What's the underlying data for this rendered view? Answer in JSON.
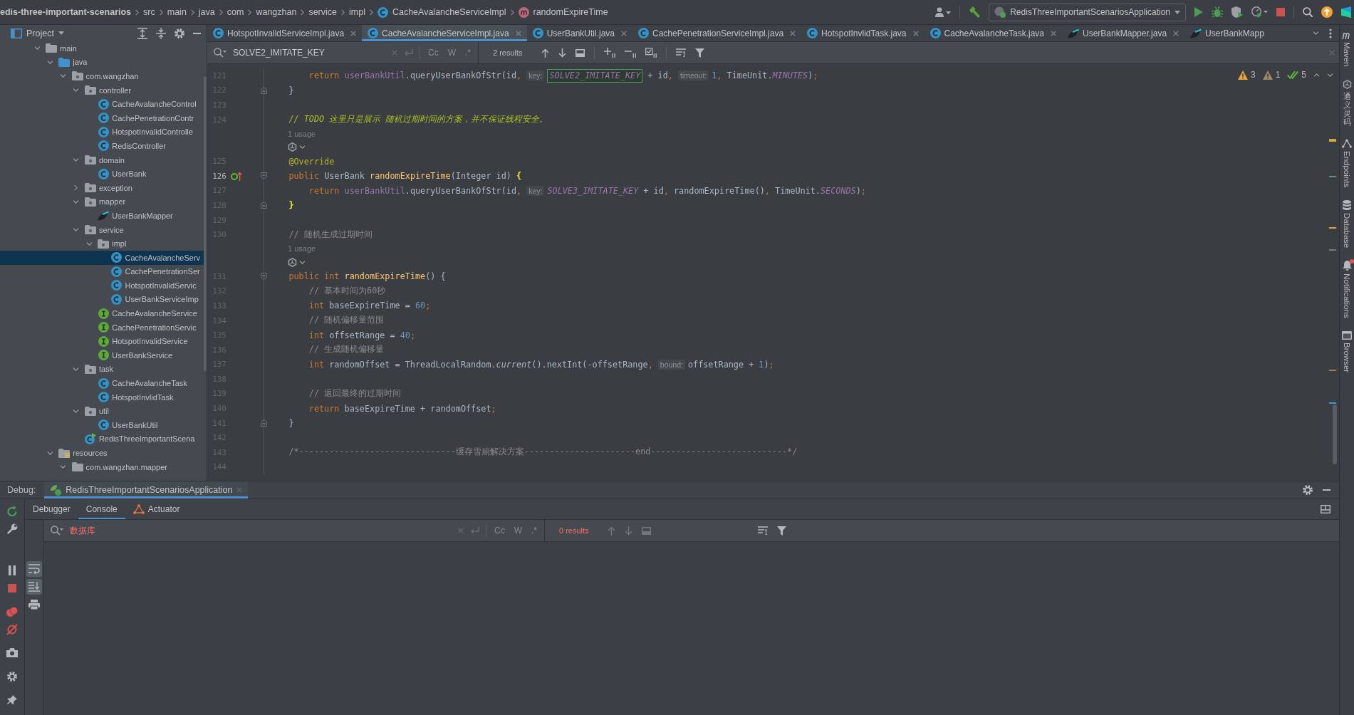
{
  "toolbar": {
    "breadcrumbs": [
      {
        "kind": "project",
        "text": "edis-three-important-scenarios"
      },
      {
        "kind": "folder",
        "text": "src"
      },
      {
        "kind": "folder",
        "text": "main"
      },
      {
        "kind": "folder",
        "text": "java"
      },
      {
        "kind": "folder",
        "text": "com"
      },
      {
        "kind": "folder",
        "text": "wangzhan"
      },
      {
        "kind": "folder",
        "text": "service"
      },
      {
        "kind": "folder",
        "text": "impl"
      },
      {
        "kind": "class",
        "text": "CacheAvalancheServiceImpl"
      },
      {
        "kind": "method",
        "text": "randomExpireTime"
      }
    ],
    "run_config": "RedisThreeImportantScenariosApplication"
  },
  "project_panel": {
    "title": "Project",
    "tree": [
      {
        "label": "main",
        "kind": "folder",
        "expanded": true,
        "selected": false,
        "children": [
          {
            "label": "java",
            "kind": "source_folder",
            "expanded": true,
            "selected": false,
            "children": [
              {
                "label": "com.wangzhan",
                "kind": "package",
                "expanded": true,
                "selected": false,
                "children": [
                  {
                    "label": "controller",
                    "kind": "package",
                    "expanded": true,
                    "selected": false,
                    "children": [
                      {
                        "label": "CacheAvalancheControl",
                        "kind": "class",
                        "selected": false
                      },
                      {
                        "label": "CachePenetrationContr",
                        "kind": "class",
                        "selected": false
                      },
                      {
                        "label": "HotspotInvalidControlle",
                        "kind": "class",
                        "selected": false
                      },
                      {
                        "label": "RedisController",
                        "kind": "class",
                        "selected": false
                      }
                    ]
                  },
                  {
                    "label": "domain",
                    "kind": "package",
                    "expanded": true,
                    "selected": false,
                    "children": [
                      {
                        "label": "UserBank",
                        "kind": "class",
                        "selected": false
                      }
                    ]
                  },
                  {
                    "label": "exception",
                    "kind": "package",
                    "expanded": false,
                    "selected": false
                  },
                  {
                    "label": "mapper",
                    "kind": "package",
                    "expanded": true,
                    "selected": false,
                    "children": [
                      {
                        "label": "UserBankMapper",
                        "kind": "mapper",
                        "selected": false
                      }
                    ]
                  },
                  {
                    "label": "service",
                    "kind": "package",
                    "expanded": true,
                    "selected": false,
                    "children": [
                      {
                        "label": "impl",
                        "kind": "package",
                        "expanded": true,
                        "selected": false,
                        "children": [
                          {
                            "label": "CacheAvalancheServ",
                            "kind": "class",
                            "selected": true
                          },
                          {
                            "label": "CachePenetrationSer",
                            "kind": "class",
                            "selected": false
                          },
                          {
                            "label": "HotspotInvalidServic",
                            "kind": "class",
                            "selected": false
                          },
                          {
                            "label": "UserBankServiceImp",
                            "kind": "class",
                            "selected": false
                          }
                        ]
                      },
                      {
                        "label": "CacheAvalancheService",
                        "kind": "interface",
                        "selected": false
                      },
                      {
                        "label": "CachePenetrationServic",
                        "kind": "interface",
                        "selected": false
                      },
                      {
                        "label": "HotspotInvalidService",
                        "kind": "interface",
                        "selected": false
                      },
                      {
                        "label": "UserBankService",
                        "kind": "interface",
                        "selected": false
                      }
                    ]
                  },
                  {
                    "label": "task",
                    "kind": "package",
                    "expanded": true,
                    "selected": false,
                    "children": [
                      {
                        "label": "CacheAvalancheTask",
                        "kind": "class",
                        "selected": false
                      },
                      {
                        "label": "HotspotInvlidTask",
                        "kind": "class",
                        "selected": false
                      }
                    ]
                  },
                  {
                    "label": "util",
                    "kind": "package",
                    "expanded": true,
                    "selected": false,
                    "children": [
                      {
                        "label": "UserBankUtil",
                        "kind": "class",
                        "selected": false
                      }
                    ]
                  },
                  {
                    "label": "RedisThreeImportantScena",
                    "kind": "application",
                    "selected": false
                  }
                ]
              }
            ]
          },
          {
            "label": "resources",
            "kind": "resources_folder",
            "expanded": true,
            "selected": false,
            "children": [
              {
                "label": "com.wangzhan.mapper",
                "kind": "folder",
                "expanded": true,
                "selected": false
              }
            ]
          }
        ]
      }
    ]
  },
  "editor_tabs": [
    {
      "label": "HotspotInvalidServiceImpl.java",
      "kind": "class",
      "selected": false,
      "closable": true
    },
    {
      "label": "CacheAvalancheServiceImpl.java",
      "kind": "class",
      "selected": true,
      "closable": true
    },
    {
      "label": "UserBankUtil.java",
      "kind": "class",
      "selected": false,
      "closable": true
    },
    {
      "label": "CachePenetrationServiceImpl.java",
      "kind": "class",
      "selected": false,
      "closable": true
    },
    {
      "label": "HotspotInvlidTask.java",
      "kind": "class",
      "selected": false,
      "closable": true
    },
    {
      "label": "CacheAvalancheTask.java",
      "kind": "class",
      "selected": false,
      "closable": true
    },
    {
      "label": "UserBankMapper.java",
      "kind": "mapper",
      "selected": false,
      "closable": true
    },
    {
      "label": "UserBankMapp",
      "kind": "mapper",
      "selected": false,
      "closable": false
    }
  ],
  "find_bar": {
    "value": "SOLVE2_IMITATE_KEY",
    "no_results": false,
    "options": [
      {
        "label": "Cc",
        "selected": false
      },
      {
        "label": "W",
        "selected": false
      },
      {
        "label": ".*",
        "selected": false
      }
    ],
    "results": "2 results"
  },
  "inspections": [
    {
      "kind": "warning",
      "count": "3"
    },
    {
      "kind": "weak_warning",
      "count": "1"
    },
    {
      "kind": "typo",
      "count": "5"
    }
  ],
  "code": [
    {
      "kind": "code",
      "number": "121",
      "current": false,
      "tokens": [
        {
          "kind": "keyword",
          "text": "        return"
        },
        {
          "kind": "field",
          "text": " userBankUtil"
        },
        {
          "kind": "text",
          "text": ".queryUserBankOfStr(id"
        },
        {
          "kind": "punct",
          "text": ","
        },
        {
          "kind": "hint",
          "text": "key:"
        },
        {
          "kind": "match",
          "text": "SOLVE2_IMITATE_KEY"
        },
        {
          "kind": "text",
          "text": " + id"
        },
        {
          "kind": "punct",
          "text": ","
        },
        {
          "kind": "hint",
          "text": "timeout:"
        },
        {
          "kind": "number",
          "text": "1"
        },
        {
          "kind": "punct",
          "text": ","
        },
        {
          "kind": "text",
          "text": " TimeUnit."
        },
        {
          "kind": "constant",
          "text": "MINUTES"
        },
        {
          "kind": "text",
          "text": ")"
        },
        {
          "kind": "punct",
          "text": ";"
        }
      ]
    },
    {
      "kind": "code",
      "number": "122",
      "current": false,
      "gutter": [
        {
          "kind": "fold_end"
        }
      ],
      "tokens": [
        {
          "kind": "text",
          "text": "    }"
        }
      ]
    },
    {
      "kind": "code",
      "number": "123",
      "current": false
    },
    {
      "kind": "code",
      "number": "124",
      "current": false,
      "tokens": [
        {
          "kind": "todo",
          "text": "    // TODO 这里只是展示 随机过期时间的方案，并不保证线程安全。"
        }
      ]
    },
    {
      "kind": "usage",
      "text": "1 usage"
    },
    {
      "kind": "vision"
    },
    {
      "kind": "code",
      "number": "125",
      "current": false,
      "tokens": [
        {
          "kind": "annotation",
          "text": "    @Override"
        }
      ]
    },
    {
      "kind": "code",
      "number": "126",
      "current": true,
      "gutter": [
        {
          "kind": "overrides"
        },
        {
          "kind": "fold_start"
        }
      ],
      "tokens": [
        {
          "kind": "keyword",
          "text": "    public"
        },
        {
          "kind": "text",
          "text": " UserBank "
        },
        {
          "kind": "method",
          "text": "randomExpireTime"
        },
        {
          "kind": "text",
          "text": "(Integer id) "
        },
        {
          "kind": "brace",
          "text": "{"
        }
      ]
    },
    {
      "kind": "code",
      "number": "127",
      "current": false,
      "tokens": [
        {
          "kind": "keyword",
          "text": "        return"
        },
        {
          "kind": "field",
          "text": " userBankUtil"
        },
        {
          "kind": "text",
          "text": ".queryUserBankOfStr(id"
        },
        {
          "kind": "punct",
          "text": ","
        },
        {
          "kind": "hint",
          "text": "key:"
        },
        {
          "kind": "constant",
          "text": "SOLVE3_IMITATE_KEY"
        },
        {
          "kind": "text",
          "text": " + id"
        },
        {
          "kind": "punct",
          "text": ","
        },
        {
          "kind": "text",
          "text": " randomExpireTime()"
        },
        {
          "kind": "punct",
          "text": ","
        },
        {
          "kind": "text",
          "text": " TimeUnit."
        },
        {
          "kind": "constant",
          "text": "SECONDS"
        },
        {
          "kind": "text",
          "text": ")"
        },
        {
          "kind": "punct",
          "text": ";"
        }
      ]
    },
    {
      "kind": "code",
      "number": "128",
      "current": false,
      "gutter": [
        {
          "kind": "fold_end"
        }
      ],
      "tokens": [
        {
          "kind": "brace",
          "text": "    }"
        }
      ]
    },
    {
      "kind": "code",
      "number": "129",
      "current": false
    },
    {
      "kind": "code",
      "number": "130",
      "current": false,
      "tokens": [
        {
          "kind": "comment",
          "text": "    // 随机生成过期时间"
        }
      ]
    },
    {
      "kind": "usage",
      "text": "1 usage"
    },
    {
      "kind": "vision"
    },
    {
      "kind": "code",
      "number": "131",
      "current": false,
      "gutter": [
        {
          "kind": "fold_start"
        }
      ],
      "tokens": [
        {
          "kind": "keyword",
          "text": "    public int "
        },
        {
          "kind": "method",
          "text": "randomExpireTime"
        },
        {
          "kind": "text",
          "text": "() {"
        }
      ]
    },
    {
      "kind": "code",
      "number": "132",
      "current": false,
      "tokens": [
        {
          "kind": "comment",
          "text": "        // 基本时间为60秒"
        }
      ]
    },
    {
      "kind": "code",
      "number": "133",
      "current": false,
      "tokens": [
        {
          "kind": "keyword",
          "text": "        int"
        },
        {
          "kind": "text",
          "text": " baseExpireTime = "
        },
        {
          "kind": "number",
          "text": "60"
        },
        {
          "kind": "punct",
          "text": ";"
        }
      ]
    },
    {
      "kind": "code",
      "number": "134",
      "current": false,
      "tokens": [
        {
          "kind": "comment",
          "text": "        // 随机偏移量范围"
        }
      ]
    },
    {
      "kind": "code",
      "number": "135",
      "current": false,
      "tokens": [
        {
          "kind": "keyword",
          "text": "        int"
        },
        {
          "kind": "text",
          "text": " offsetRange = "
        },
        {
          "kind": "number",
          "text": "40"
        },
        {
          "kind": "punct",
          "text": ";"
        }
      ]
    },
    {
      "kind": "code",
      "number": "136",
      "current": false,
      "tokens": [
        {
          "kind": "comment",
          "text": "        // 生成随机偏移量"
        }
      ]
    },
    {
      "kind": "code",
      "number": "137",
      "current": false,
      "tokens": [
        {
          "kind": "keyword",
          "text": "        int"
        },
        {
          "kind": "text",
          "text": " randomOffset = ThreadLocalRandom."
        },
        {
          "kind": "static_method",
          "text": "current"
        },
        {
          "kind": "text",
          "text": "().nextInt(-offsetRange"
        },
        {
          "kind": "punct",
          "text": ","
        },
        {
          "kind": "hint",
          "text": "bound:"
        },
        {
          "kind": "text",
          "text": "offsetRange + "
        },
        {
          "kind": "number",
          "text": "1"
        },
        {
          "kind": "text",
          "text": ")"
        },
        {
          "kind": "punct",
          "text": ";"
        }
      ]
    },
    {
      "kind": "code",
      "number": "138",
      "current": false
    },
    {
      "kind": "code",
      "number": "139",
      "current": false,
      "tokens": [
        {
          "kind": "comment",
          "text": "        // 返回最终的过期时间"
        }
      ]
    },
    {
      "kind": "code",
      "number": "140",
      "current": false,
      "tokens": [
        {
          "kind": "keyword",
          "text": "        return"
        },
        {
          "kind": "text",
          "text": " baseExpireTime + randomOffset"
        },
        {
          "kind": "punct",
          "text": ";"
        }
      ]
    },
    {
      "kind": "code",
      "number": "141",
      "current": false,
      "gutter": [
        {
          "kind": "fold_end"
        }
      ],
      "tokens": [
        {
          "kind": "text",
          "text": "    }"
        }
      ]
    },
    {
      "kind": "code",
      "number": "142",
      "current": false
    },
    {
      "kind": "code",
      "number": "143",
      "current": false,
      "tokens": [
        {
          "kind": "comment",
          "text": "    /*-------------------------------缓存雪崩解决方案----------------------end---------------------------*/"
        }
      ]
    },
    {
      "kind": "code",
      "number": "144",
      "current": false
    }
  ],
  "tool_windows": [
    {
      "label": "Maven",
      "kind": "maven",
      "unread": false
    },
    {
      "label": "通义灵码",
      "kind": "assistant",
      "unread": false
    },
    {
      "label": "Endpoints",
      "kind": "endpoints",
      "unread": false
    },
    {
      "label": "Database",
      "kind": "database",
      "unread": false
    },
    {
      "label": "Notifications",
      "kind": "notifications",
      "unread": true
    },
    {
      "label": "Browser",
      "kind": "browser",
      "unread": false
    }
  ],
  "debug": {
    "title": "Debug:",
    "session": {
      "label": "RedisThreeImportantScenariosApplication",
      "selected": true
    },
    "tabs": [
      {
        "label": "Debugger",
        "kind": "plain",
        "selected": false
      },
      {
        "label": "Console",
        "kind": "plain",
        "selected": true
      },
      {
        "label": "Actuator",
        "kind": "actuator",
        "selected": false
      }
    ],
    "console_tools": [
      {
        "kind": "soft_wrap",
        "selected": true
      },
      {
        "kind": "scroll_to_end",
        "selected": true
      },
      {
        "kind": "print",
        "selected": false
      }
    ],
    "find_bar": {
      "value": "数据库",
      "no_results": true,
      "options": [
        {
          "label": "Cc",
          "selected": false
        },
        {
          "label": "W",
          "selected": false
        },
        {
          "label": ".*",
          "selected": false
        }
      ],
      "results": "0 results"
    }
  }
}
